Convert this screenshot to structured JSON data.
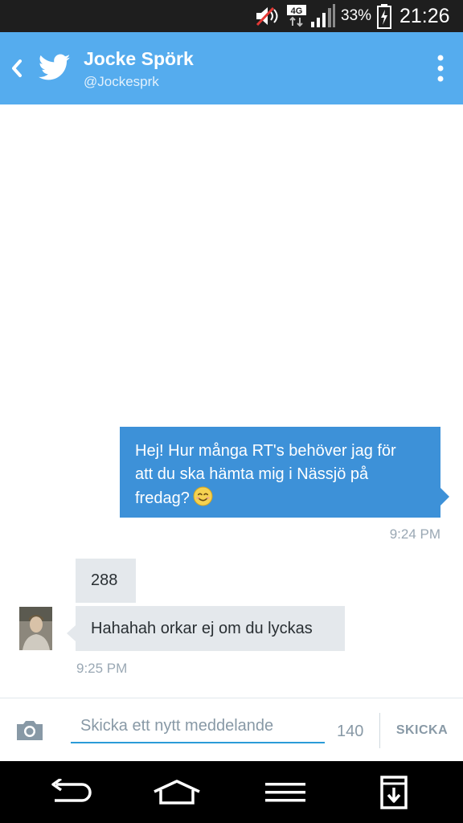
{
  "status_bar": {
    "battery_percent": "33%",
    "time": "21:26",
    "network_label": "4G",
    "icons": [
      "mute-icon",
      "4g-data-icon",
      "signal-icon",
      "battery-charging-icon"
    ]
  },
  "app_bar": {
    "title": "Jocke Spörk",
    "handle": "@Jockesprk",
    "icons": [
      "back-icon",
      "twitter-bird-icon",
      "overflow-menu-icon"
    ],
    "color": "#55acee"
  },
  "conversation": {
    "messages": [
      {
        "direction": "outgoing",
        "lines": [
          "Hej! Hur många RT's behöver jag för",
          "att du ska hämta mig i Nässjö på",
          "fredag?"
        ],
        "emoji": "smiling-face-icon",
        "time": "9:24 PM"
      },
      {
        "direction": "incoming",
        "text": "288"
      },
      {
        "direction": "incoming",
        "text": "Hahahah orkar ej om du lyckas",
        "time": "9:25 PM"
      }
    ],
    "outgoing_color": "#3d91d8",
    "incoming_color": "#e4e8ec"
  },
  "composer": {
    "placeholder": "Skicka ett nytt meddelande",
    "char_count": "140",
    "send_label": "SKICKA",
    "camera_icon": "camera-icon"
  },
  "nav_bar": {
    "icons": [
      "back-nav-icon",
      "home-nav-icon",
      "menu-nav-icon",
      "download-nav-icon"
    ]
  }
}
